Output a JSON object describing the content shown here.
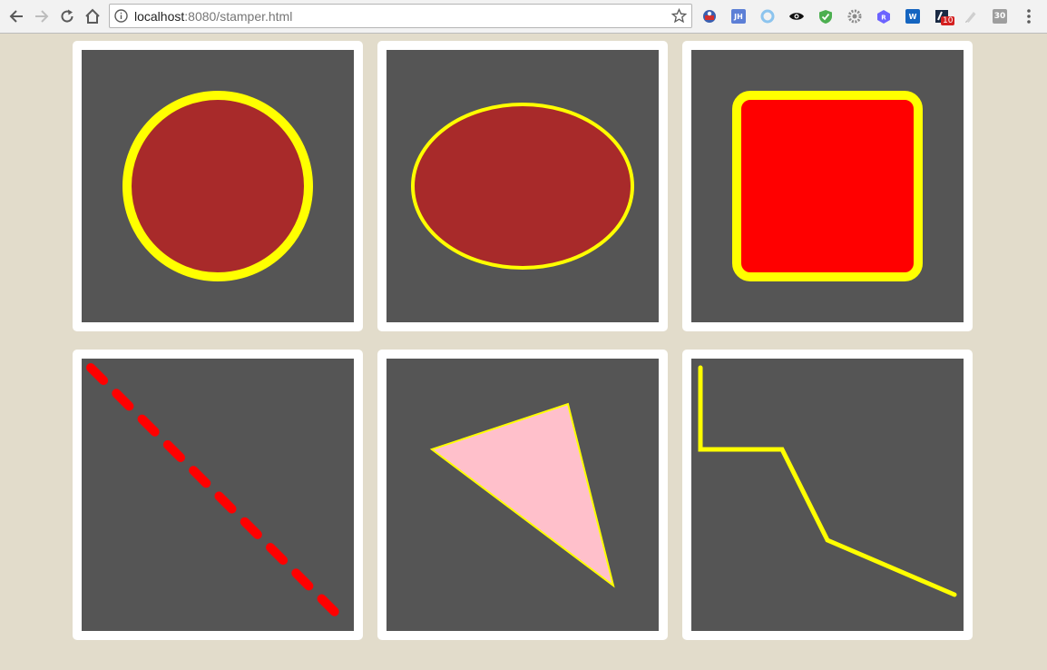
{
  "browser": {
    "address_host": "localhost",
    "address_path": ":8080/stamper.html",
    "extensions": {
      "jh_label": "JH",
      "w_label": "W",
      "r_label": "R",
      "badge_count": "10",
      "last_label": "30"
    }
  },
  "colors": {
    "page_background": "#e2dccb",
    "tile_background": "#ffffff",
    "canvas_background": "#555555",
    "fill_brown": "#a82a2a",
    "fill_red": "#ff0000",
    "fill_pink": "#ffc0cb",
    "stroke_yellow": "#ffff00"
  },
  "stamps": [
    {
      "shape": "circle",
      "fill": "brown",
      "stroke": "yellow"
    },
    {
      "shape": "ellipse",
      "fill": "brown",
      "stroke": "yellow"
    },
    {
      "shape": "rounded-rectangle",
      "fill": "red",
      "stroke": "yellow"
    },
    {
      "shape": "dashed-line",
      "stroke": "red"
    },
    {
      "shape": "triangle",
      "fill": "pink",
      "stroke": "yellow"
    },
    {
      "shape": "polyline",
      "stroke": "yellow"
    }
  ]
}
